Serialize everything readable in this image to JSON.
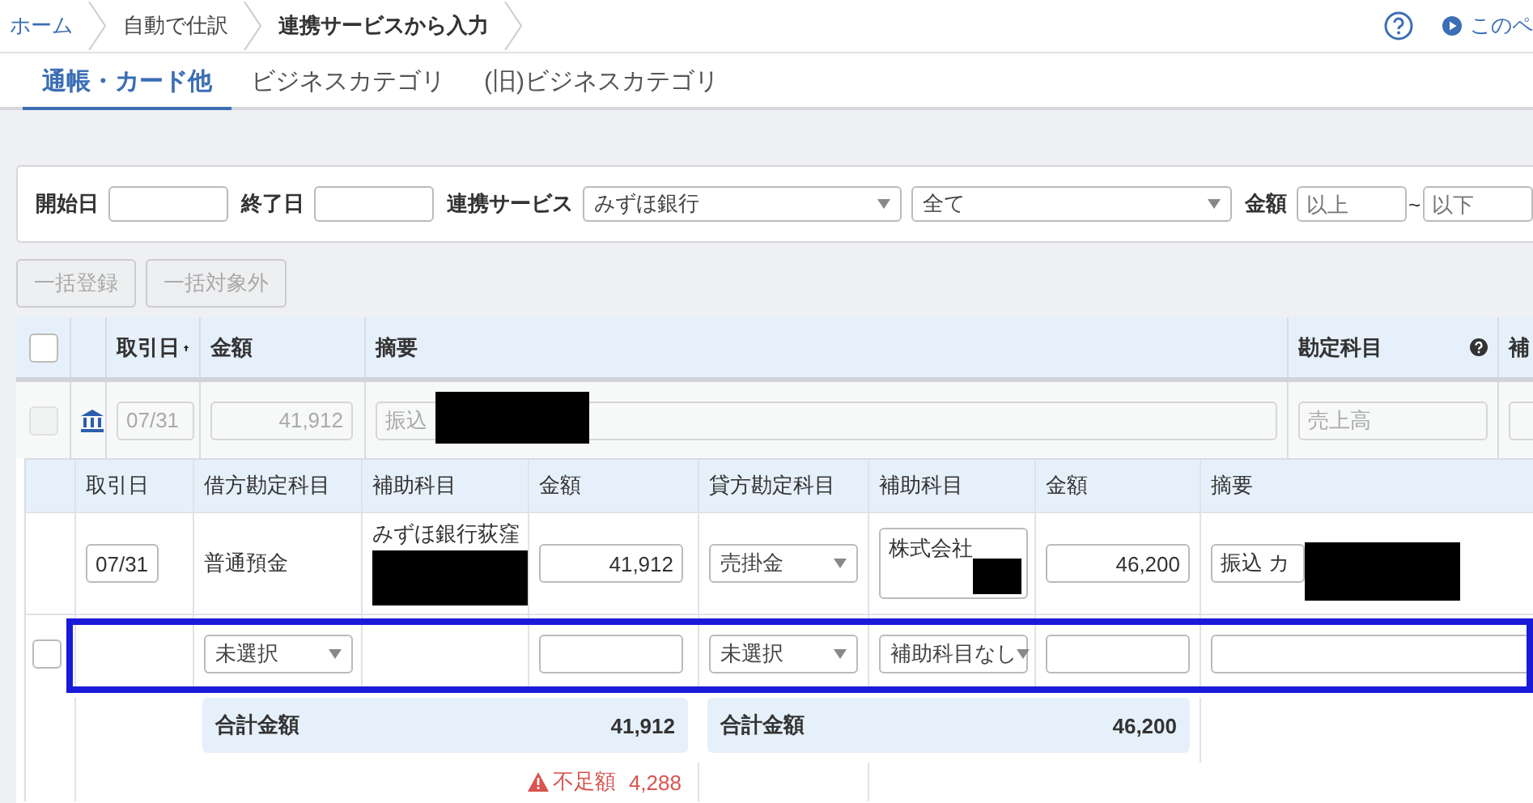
{
  "breadcrumbs": [
    {
      "label": "ホーム",
      "current": false
    },
    {
      "label": "自動で仕訳",
      "current": false
    },
    {
      "label": "連携サービスから入力",
      "current": true
    }
  ],
  "guide_link": "このペ",
  "tabs": [
    {
      "label": "通帳・カード他",
      "selected": true
    },
    {
      "label": "ビジネスカテゴリ",
      "selected": false
    },
    {
      "label": "(旧)ビジネスカテゴリ",
      "selected": false
    }
  ],
  "filters": {
    "start_date": {
      "label": "開始日"
    },
    "end_date": {
      "label": "終了日"
    },
    "service": {
      "label": "連携サービス",
      "value": "みずほ銀行"
    },
    "status": {
      "value": "全て"
    },
    "amount": {
      "label": "金額",
      "min_placeholder": "以上",
      "separator": "~",
      "max_placeholder": "以下"
    }
  },
  "bulk_buttons": [
    {
      "label": "一括登録",
      "disabled": true
    },
    {
      "label": "一括対象外",
      "disabled": true
    }
  ],
  "table": {
    "select_all_checked": false,
    "columns": [
      {
        "label": "取引日",
        "kind": "sorted"
      },
      {
        "label": "金額",
        "kind": "plain"
      },
      {
        "label": "摘要",
        "kind": "plain"
      },
      {
        "label": "勘定科目",
        "kind": "help"
      },
      {
        "label": "補",
        "kind": "plain"
      }
    ],
    "row": {
      "checked": false,
      "disabled": true,
      "date": "07/31",
      "amount": "41,912",
      "description": "振込",
      "account": "売上高"
    }
  },
  "detail": {
    "columns": [
      "取引日",
      "借方勘定科目",
      "補助科目",
      "金額",
      "貸方勘定科目",
      "補助科目",
      "金額",
      "摘要"
    ],
    "entries": [
      {
        "kind": "filled",
        "date": "07/31",
        "debit_account": "普通預金",
        "debit_sub": "みずほ銀行荻窪",
        "debit_amount": "41,912",
        "credit_account": "売掛金",
        "credit_sub": "株式会社",
        "credit_amount": "46,200",
        "description": "振込 カ"
      },
      {
        "kind": "empty",
        "checked": false,
        "highlighted": true,
        "debit_account": "未選択",
        "credit_account": "未選択",
        "credit_sub": "補助科目なし"
      }
    ],
    "totals": {
      "debit": {
        "label": "合計金額",
        "value": "41,912"
      },
      "credit": {
        "label": "合計金額",
        "value": "46,200"
      },
      "shortage": {
        "label": "不足額",
        "value": "4,288"
      }
    }
  }
}
